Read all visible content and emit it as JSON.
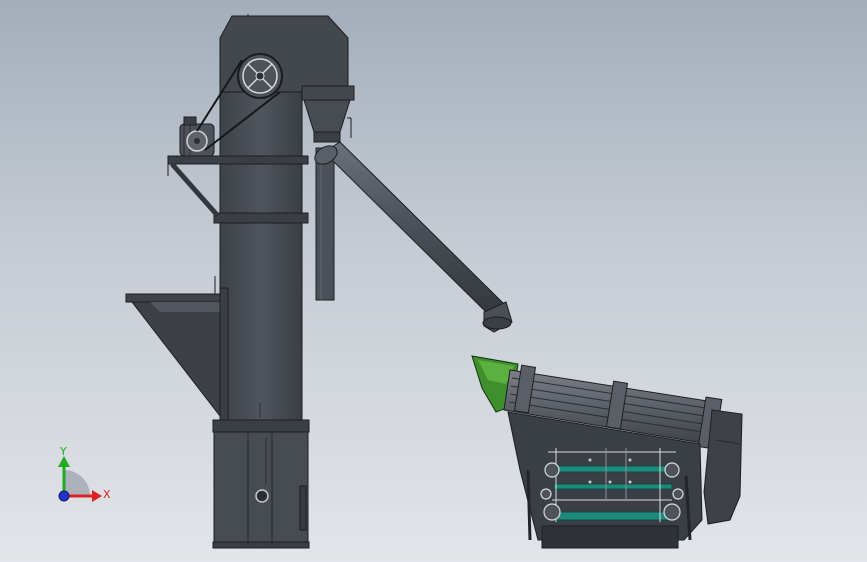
{
  "viewport": {
    "background_top": "#a3aebb",
    "background_bottom": "#e2e5e9"
  },
  "triad": {
    "y_label": "Y",
    "x_label": "X",
    "y_color": "#22aa22",
    "x_color": "#dd2222",
    "origin_color": "#2233cc"
  },
  "model": {
    "elevator_color": "#474b52",
    "separator_hopper_color": "#3f8f2e",
    "roller_color": "#1e8a7c",
    "components": [
      "bucket-elevator",
      "drive-motor",
      "drive-pulley",
      "discharge-spout",
      "discharge-chute",
      "inlet-hopper",
      "screen-separator"
    ]
  }
}
